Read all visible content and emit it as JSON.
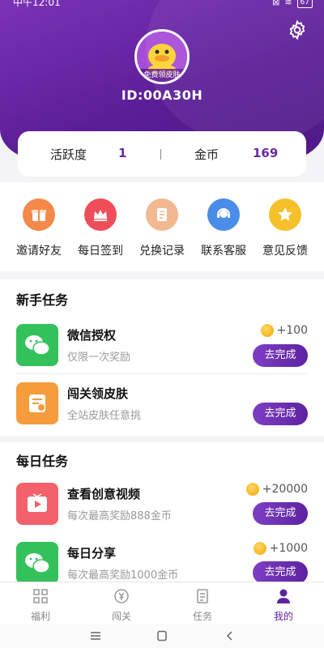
{
  "status_bar": {
    "time": "中午12:01",
    "battery": "67"
  },
  "profile": {
    "avatar_badge": "免费领皮肤",
    "user_id": "ID:00A30H"
  },
  "stats": {
    "activity_label": "活跃度",
    "activity_value": "1",
    "coins_label": "金币",
    "coins_value": "169"
  },
  "quick_actions": [
    {
      "label": "邀请好友",
      "icon": "gift-icon",
      "color": "#f5894a"
    },
    {
      "label": "每日签到",
      "icon": "crown-icon",
      "color": "#f04d5a"
    },
    {
      "label": "兑换记录",
      "icon": "ticket-icon",
      "color": "#f2b88f"
    },
    {
      "label": "联系客服",
      "icon": "headset-icon",
      "color": "#4a8de8"
    },
    {
      "label": "意见反馈",
      "icon": "star-icon",
      "color": "#f5c02a"
    }
  ],
  "newbie_section": {
    "title": "新手任务",
    "tasks": [
      {
        "title": "微信授权",
        "desc": "仅限一次奖励",
        "reward": "+100",
        "button": "去完成",
        "icon": "wechat-icon"
      },
      {
        "title": "闯关领皮肤",
        "desc": "全站皮肤任意挑",
        "reward": "",
        "button": "去完成",
        "icon": "coupon-icon"
      }
    ]
  },
  "daily_section": {
    "title": "每日任务",
    "tasks": [
      {
        "title": "查看创意视频",
        "desc": "每次最高奖励888金币",
        "reward": "+20000",
        "button": "去完成",
        "icon": "video-play-icon"
      },
      {
        "title": "每日分享",
        "desc": "每次最高奖励1000金币",
        "reward": "+1000",
        "button": "去完成",
        "icon": "wechat-icon"
      }
    ]
  },
  "tabbar": [
    {
      "label": "福利",
      "icon": "grid-icon"
    },
    {
      "label": "闯关",
      "icon": "yen-coin-icon"
    },
    {
      "label": "任务",
      "icon": "document-icon"
    },
    {
      "label": "我的",
      "icon": "person-icon",
      "active": true
    }
  ],
  "colors": {
    "brand_purple": "#5d22a0",
    "header_purple": "#7b32b8"
  }
}
